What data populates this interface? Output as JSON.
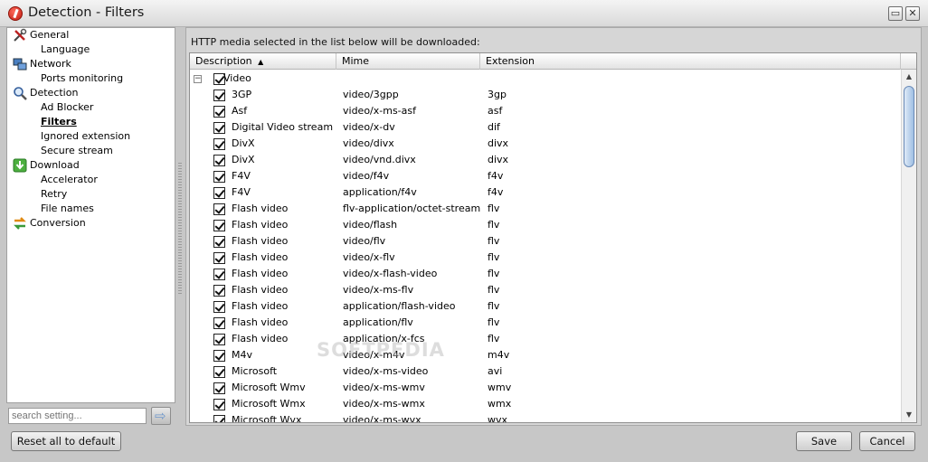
{
  "window": {
    "title": "Detection - Filters",
    "buttons": [
      "restore",
      "close"
    ]
  },
  "sidebar": {
    "items": [
      {
        "label": "General",
        "icon": "tools-icon",
        "level": 0
      },
      {
        "label": "Language",
        "level": 1
      },
      {
        "label": "Network",
        "icon": "network-icon",
        "level": 0
      },
      {
        "label": "Ports monitoring",
        "level": 1
      },
      {
        "label": "Detection",
        "icon": "magnifier-icon",
        "level": 0
      },
      {
        "label": "Ad Blocker",
        "level": 1
      },
      {
        "label": "Filters",
        "level": 1,
        "selected": true
      },
      {
        "label": "Ignored extension",
        "level": 1
      },
      {
        "label": "Secure stream",
        "level": 1
      },
      {
        "label": "Download",
        "icon": "download-icon",
        "level": 0
      },
      {
        "label": "Accelerator",
        "level": 1
      },
      {
        "label": "Retry",
        "level": 1
      },
      {
        "label": "File names",
        "level": 1
      },
      {
        "label": "Conversion",
        "icon": "conversion-icon",
        "level": 0
      }
    ],
    "search": {
      "placeholder": "search setting..."
    }
  },
  "main": {
    "hint": "HTTP media selected in the list below will be downloaded:",
    "columns": [
      "Description",
      "Mime",
      "Extension"
    ],
    "sort_indicator": "▲",
    "group": {
      "label": "Video",
      "expander": "−",
      "checked": true
    },
    "rows": [
      {
        "description": "3GP",
        "mime": "video/3gpp",
        "extension": "3gp"
      },
      {
        "description": "Asf",
        "mime": "video/x-ms-asf",
        "extension": "asf"
      },
      {
        "description": "Digital Video stream",
        "mime": "video/x-dv",
        "extension": "dif"
      },
      {
        "description": "DivX",
        "mime": "video/divx",
        "extension": "divx"
      },
      {
        "description": "DivX",
        "mime": "video/vnd.divx",
        "extension": "divx"
      },
      {
        "description": "F4V",
        "mime": "video/f4v",
        "extension": "f4v"
      },
      {
        "description": "F4V",
        "mime": "application/f4v",
        "extension": "f4v"
      },
      {
        "description": "Flash video",
        "mime": "flv-application/octet-stream",
        "extension": "flv"
      },
      {
        "description": "Flash video",
        "mime": "video/flash",
        "extension": "flv"
      },
      {
        "description": "Flash video",
        "mime": "video/flv",
        "extension": "flv"
      },
      {
        "description": "Flash video",
        "mime": "video/x-flv",
        "extension": "flv"
      },
      {
        "description": "Flash video",
        "mime": "video/x-flash-video",
        "extension": "flv"
      },
      {
        "description": "Flash video",
        "mime": "video/x-ms-flv",
        "extension": "flv"
      },
      {
        "description": "Flash video",
        "mime": "application/flash-video",
        "extension": "flv"
      },
      {
        "description": "Flash video",
        "mime": "application/flv",
        "extension": "flv"
      },
      {
        "description": "Flash video",
        "mime": "application/x-fcs",
        "extension": "flv"
      },
      {
        "description": "M4v",
        "mime": "video/x-m4v",
        "extension": "m4v"
      },
      {
        "description": "Microsoft",
        "mime": "video/x-ms-video",
        "extension": "avi"
      },
      {
        "description": "Microsoft Wmv",
        "mime": "video/x-ms-wmv",
        "extension": "wmv"
      },
      {
        "description": "Microsoft Wmx",
        "mime": "video/x-ms-wmx",
        "extension": "wmx"
      },
      {
        "description": "Microsoft Wvx",
        "mime": "video/x-ms-wvx",
        "extension": "wvx"
      }
    ]
  },
  "footer": {
    "reset": "Reset all to default",
    "save": "Save",
    "cancel": "Cancel"
  },
  "watermark": "SOFTPEDIA"
}
